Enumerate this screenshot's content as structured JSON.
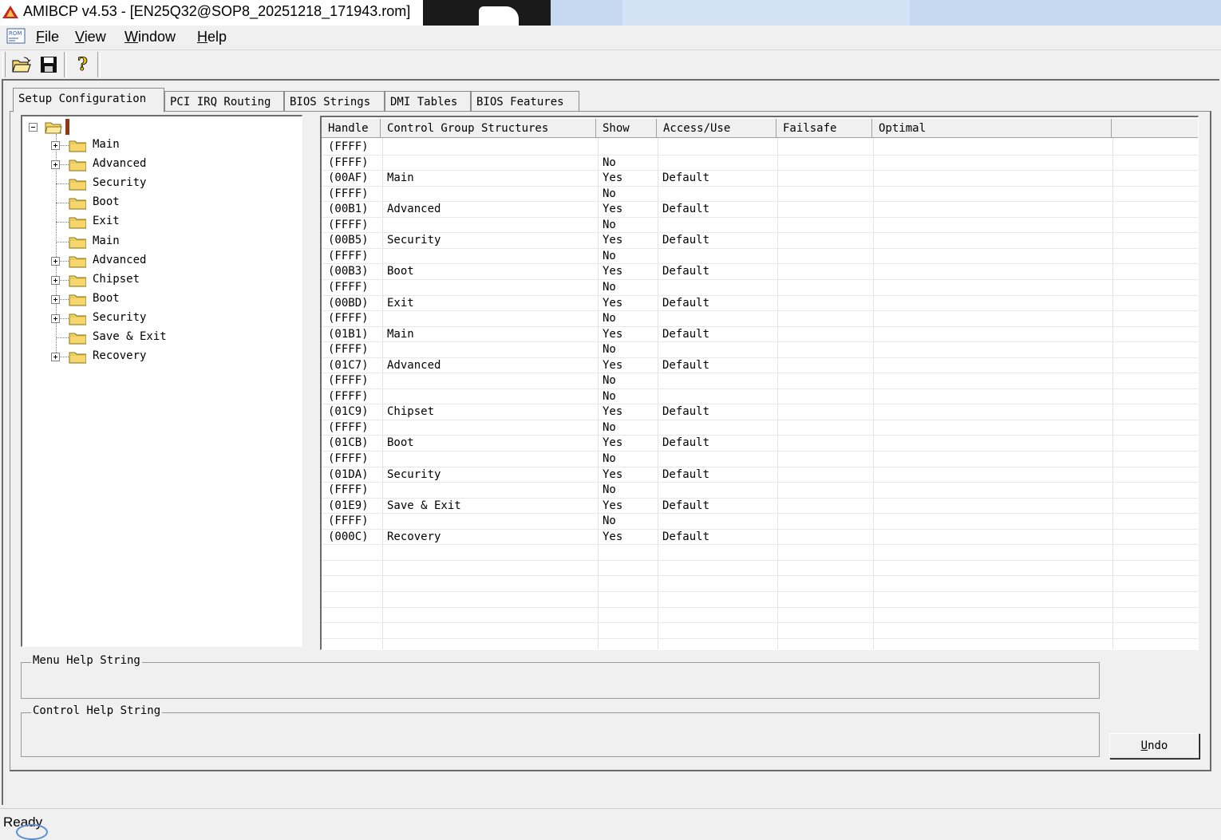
{
  "window": {
    "title": "AMIBCP v4.53 - [EN25Q32@SOP8_20251218_171943.rom]"
  },
  "menu": {
    "file": {
      "label": "File",
      "mnemonic": "F",
      "rest": "ile"
    },
    "view": {
      "label": "View",
      "mnemonic": "V",
      "rest": "iew"
    },
    "window": {
      "label": "Window",
      "mnemonic": "W",
      "rest": "indow"
    },
    "help": {
      "label": "Help",
      "mnemonic": "H",
      "rest": "elp"
    }
  },
  "toolbar": {
    "open_icon": "folder-open-icon",
    "save_icon": "floppy-disk-icon",
    "help_icon": "question-mark-icon"
  },
  "tabs": [
    {
      "label": "Setup Configuration",
      "active": true
    },
    {
      "label": "PCI IRQ Routing"
    },
    {
      "label": "BIOS Strings"
    },
    {
      "label": "DMI Tables"
    },
    {
      "label": "BIOS Features"
    }
  ],
  "tree": {
    "items": [
      {
        "label": "Main",
        "expandable": true
      },
      {
        "label": "Advanced",
        "expandable": true
      },
      {
        "label": "Security",
        "expandable": false
      },
      {
        "label": "Boot",
        "expandable": false
      },
      {
        "label": "Exit",
        "expandable": false
      },
      {
        "label": "Main",
        "expandable": false
      },
      {
        "label": "Advanced",
        "expandable": true
      },
      {
        "label": "Chipset",
        "expandable": true
      },
      {
        "label": "Boot",
        "expandable": true
      },
      {
        "label": "Security",
        "expandable": true
      },
      {
        "label": "Save & Exit",
        "expandable": false
      },
      {
        "label": "Recovery",
        "expandable": true
      }
    ]
  },
  "grid": {
    "columns": [
      "Handle",
      "Control Group Structures",
      "Show",
      "Access/Use",
      "Failsafe",
      "Optimal"
    ],
    "rows": [
      {
        "handle": "(FFFF)",
        "name": "",
        "show": "",
        "access": ""
      },
      {
        "handle": "(FFFF)",
        "name": "",
        "show": "No",
        "access": ""
      },
      {
        "handle": "(00AF)",
        "name": "Main",
        "show": "Yes",
        "access": "Default"
      },
      {
        "handle": "(FFFF)",
        "name": "",
        "show": "No",
        "access": ""
      },
      {
        "handle": "(00B1)",
        "name": "Advanced",
        "show": "Yes",
        "access": "Default"
      },
      {
        "handle": "(FFFF)",
        "name": "",
        "show": "No",
        "access": ""
      },
      {
        "handle": "(00B5)",
        "name": "Security",
        "show": "Yes",
        "access": "Default"
      },
      {
        "handle": "(FFFF)",
        "name": "",
        "show": "No",
        "access": ""
      },
      {
        "handle": "(00B3)",
        "name": "Boot",
        "show": "Yes",
        "access": "Default"
      },
      {
        "handle": "(FFFF)",
        "name": "",
        "show": "No",
        "access": ""
      },
      {
        "handle": "(00BD)",
        "name": "Exit",
        "show": "Yes",
        "access": "Default"
      },
      {
        "handle": "(FFFF)",
        "name": "",
        "show": "No",
        "access": ""
      },
      {
        "handle": "(01B1)",
        "name": "Main",
        "show": "Yes",
        "access": "Default"
      },
      {
        "handle": "(FFFF)",
        "name": "",
        "show": "No",
        "access": ""
      },
      {
        "handle": "(01C7)",
        "name": "Advanced",
        "show": "Yes",
        "access": "Default"
      },
      {
        "handle": "(FFFF)",
        "name": "",
        "show": "No",
        "access": ""
      },
      {
        "handle": "(FFFF)",
        "name": "",
        "show": "No",
        "access": ""
      },
      {
        "handle": "(01C9)",
        "name": "Chipset",
        "show": "Yes",
        "access": "Default"
      },
      {
        "handle": "(FFFF)",
        "name": "",
        "show": "No",
        "access": ""
      },
      {
        "handle": "(01CB)",
        "name": "Boot",
        "show": "Yes",
        "access": "Default"
      },
      {
        "handle": "(FFFF)",
        "name": "",
        "show": "No",
        "access": ""
      },
      {
        "handle": "(01DA)",
        "name": "Security",
        "show": "Yes",
        "access": "Default"
      },
      {
        "handle": "(FFFF)",
        "name": "",
        "show": "No",
        "access": ""
      },
      {
        "handle": "(01E9)",
        "name": "Save & Exit",
        "show": "Yes",
        "access": "Default"
      },
      {
        "handle": "(FFFF)",
        "name": "",
        "show": "No",
        "access": ""
      },
      {
        "handle": "(000C)",
        "name": "Recovery",
        "show": "Yes",
        "access": "Default"
      }
    ]
  },
  "help": {
    "menu_help_label": "Menu Help String",
    "control_help_label": "Control Help String"
  },
  "undo": {
    "label": "Undo",
    "mnemonic": "U",
    "rest": "ndo"
  },
  "status": {
    "text": "Ready"
  },
  "colors": {
    "folder": "#f5d76e",
    "window_bg": "#f0f0f0",
    "title_blue": "#c6d9f0"
  }
}
